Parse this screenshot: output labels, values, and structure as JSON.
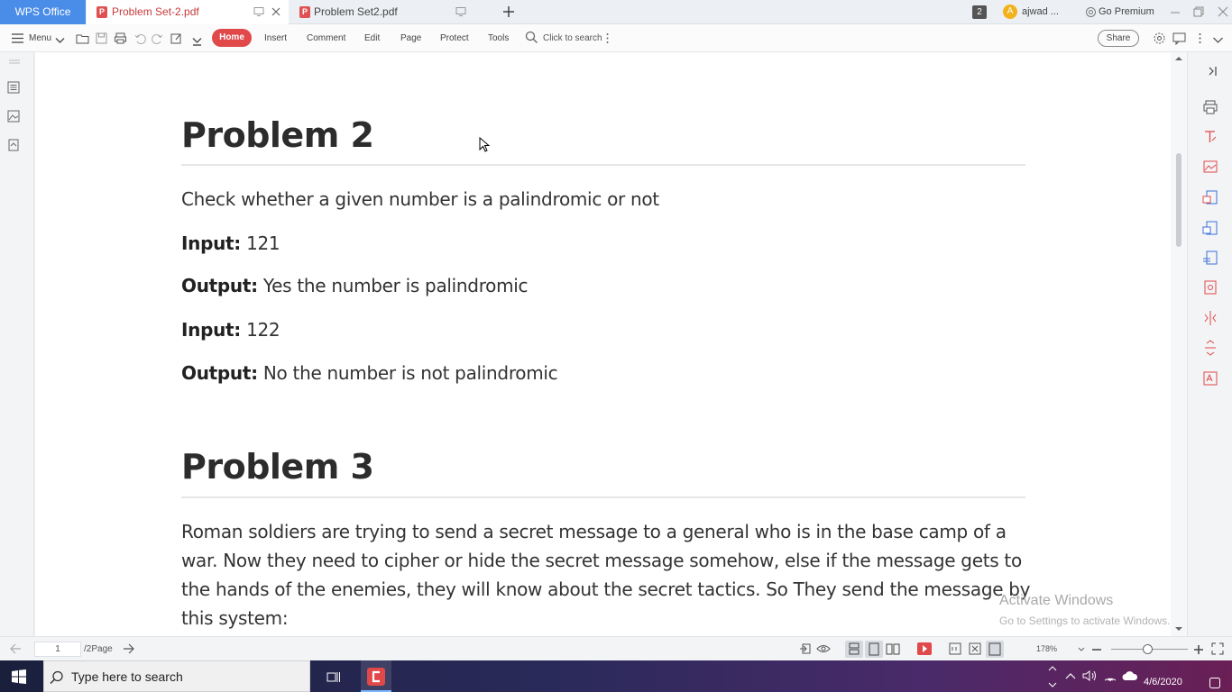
{
  "titlebar": {
    "app_tab": "WPS Office",
    "tabs": [
      {
        "label": "Problem Set-2.pdf",
        "active": true
      },
      {
        "label": "Problem Set2.pdf",
        "active": false
      }
    ],
    "notification_count": "2",
    "user_initial": "A",
    "user_name": "ajwad ...",
    "premium_label": "Go Premium"
  },
  "toolbar": {
    "menu_label": "Menu",
    "tabs": [
      "Home",
      "Insert",
      "Comment",
      "Edit",
      "Page",
      "Protect",
      "Tools"
    ],
    "search_placeholder": "Click to search",
    "share_label": "Share"
  },
  "document": {
    "problem2": {
      "heading": "Problem 2",
      "description": "Check whether a given number is a palindromic or not",
      "examples": [
        {
          "label": "Input:",
          "value": "121"
        },
        {
          "label": "Output:",
          "value": "Yes the number is palindromic"
        },
        {
          "label": "Input:",
          "value": "122"
        },
        {
          "label": "Output:",
          "value": "No the number is not palindromic"
        }
      ]
    },
    "problem3": {
      "heading": "Problem 3",
      "text": "Roman soldiers are trying to send a secret message to a general who is in the base camp of a war. Now they need to cipher or hide the secret message somehow, else if the message gets to the hands of the enemies, they will know about the secret tactics. So They send the message by this system:"
    }
  },
  "watermark": {
    "title": "Activate Windows",
    "subtitle": "Go to Settings to activate Windows."
  },
  "statusbar": {
    "page_number": "1",
    "page_total": "/2Page",
    "zoom": "178%"
  },
  "taskbar": {
    "search_placeholder": "Type here to search",
    "date": "4/6/2020"
  },
  "colors": {
    "accent_red": "#e0484a",
    "wps_blue": "#4a8de8"
  }
}
